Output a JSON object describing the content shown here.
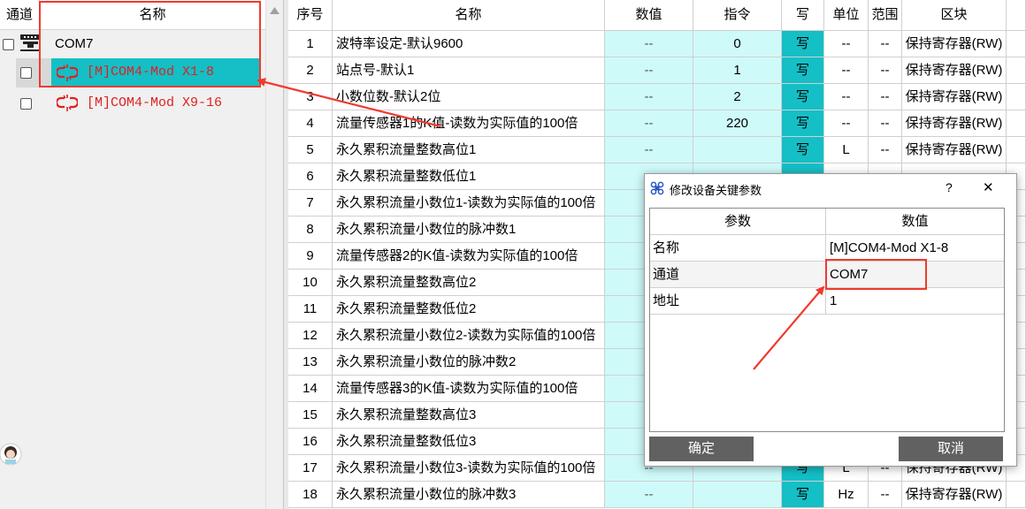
{
  "tree": {
    "header": {
      "channel": "通道",
      "name": "名称"
    },
    "port": "COM7",
    "items": [
      {
        "label": "[M]COM4-Mod X1-8",
        "selected": true
      },
      {
        "label": "[M]COM4-Mod X9-16",
        "selected": false
      }
    ]
  },
  "grid": {
    "headers": [
      "序号",
      "名称",
      "数值",
      "指令",
      "写",
      "单位",
      "范围",
      "区块"
    ],
    "rows": [
      {
        "no": "1",
        "name": "波特率设定-默认9600",
        "value": "--",
        "cmd": "0",
        "write": "写",
        "unit": "--",
        "range": "--",
        "block": "保持寄存器(RW)"
      },
      {
        "no": "2",
        "name": "站点号-默认1",
        "value": "--",
        "cmd": "1",
        "write": "写",
        "unit": "--",
        "range": "--",
        "block": "保持寄存器(RW)"
      },
      {
        "no": "3",
        "name": "小数位数-默认2位",
        "value": "--",
        "cmd": "2",
        "write": "写",
        "unit": "--",
        "range": "--",
        "block": "保持寄存器(RW)"
      },
      {
        "no": "4",
        "name": "流量传感器1的K值-读数为实际值的100倍",
        "value": "--",
        "cmd": "220",
        "write": "写",
        "unit": "--",
        "range": "--",
        "block": "保持寄存器(RW)"
      },
      {
        "no": "5",
        "name": "永久累积流量整数高位1",
        "value": "--",
        "cmd": "",
        "write": "写",
        "unit": "L",
        "range": "--",
        "block": "保持寄存器(RW)"
      },
      {
        "no": "6",
        "name": "永久累积流量整数低位1",
        "value": "",
        "cmd": "",
        "write": "",
        "unit": "",
        "range": "",
        "block": ""
      },
      {
        "no": "7",
        "name": "永久累积流量小数位1-读数为实际值的100倍",
        "value": "",
        "cmd": "",
        "write": "",
        "unit": "",
        "range": "",
        "block": ""
      },
      {
        "no": "8",
        "name": " 永久累积流量小数位的脉冲数1",
        "value": "",
        "cmd": "",
        "write": "",
        "unit": "",
        "range": "",
        "block": ""
      },
      {
        "no": "9",
        "name": "流量传感器2的K值-读数为实际值的100倍",
        "value": "",
        "cmd": "",
        "write": "",
        "unit": "",
        "range": "",
        "block": ""
      },
      {
        "no": "10",
        "name": "永久累积流量整数高位2",
        "value": "",
        "cmd": "",
        "write": "",
        "unit": "",
        "range": "",
        "block": ""
      },
      {
        "no": "11",
        "name": "永久累积流量整数低位2",
        "value": "",
        "cmd": "",
        "write": "",
        "unit": "",
        "range": "",
        "block": ""
      },
      {
        "no": "12",
        "name": "永久累积流量小数位2-读数为实际值的100倍",
        "value": "",
        "cmd": "",
        "write": "",
        "unit": "",
        "range": "",
        "block": ""
      },
      {
        "no": "13",
        "name": "永久累积流量小数位的脉冲数2",
        "value": "",
        "cmd": "",
        "write": "",
        "unit": "",
        "range": "",
        "block": ""
      },
      {
        "no": "14",
        "name": "流量传感器3的K值-读数为实际值的100倍",
        "value": "",
        "cmd": "",
        "write": "",
        "unit": "",
        "range": "",
        "block": ""
      },
      {
        "no": "15",
        "name": "永久累积流量整数高位3",
        "value": "",
        "cmd": "",
        "write": "",
        "unit": "",
        "range": "",
        "block": ""
      },
      {
        "no": "16",
        "name": "永久累积流量整数低位3",
        "value": "",
        "cmd": "",
        "write": "",
        "unit": "",
        "range": "",
        "block": ""
      },
      {
        "no": "17",
        "name": "永久累积流量小数位3-读数为实际值的100倍",
        "value": "--",
        "cmd": "",
        "write": "写",
        "unit": "L",
        "range": "--",
        "block": "保持寄存器(RW)"
      },
      {
        "no": "18",
        "name": "永久累积流量小数位的脉冲数3",
        "value": "--",
        "cmd": "",
        "write": "写",
        "unit": "Hz",
        "range": "--",
        "block": "保持寄存器(RW)"
      }
    ]
  },
  "dialog": {
    "title": "修改设备关键参数",
    "help": "?",
    "close": "✕",
    "headers": {
      "param": "参数",
      "value": "数值"
    },
    "rows": [
      {
        "param": "名称",
        "value": "[M]COM4-Mod X1-8"
      },
      {
        "param": "通道",
        "value": "COM7"
      },
      {
        "param": "地址",
        "value": "1"
      }
    ],
    "ok": "确定",
    "cancel": "取消"
  },
  "colors": {
    "accent": "#14bfc6",
    "light_cyan": "#cffafa",
    "annotation_red": "#f03a2e",
    "tree_text": "#e02020",
    "button_gray": "#616161"
  }
}
